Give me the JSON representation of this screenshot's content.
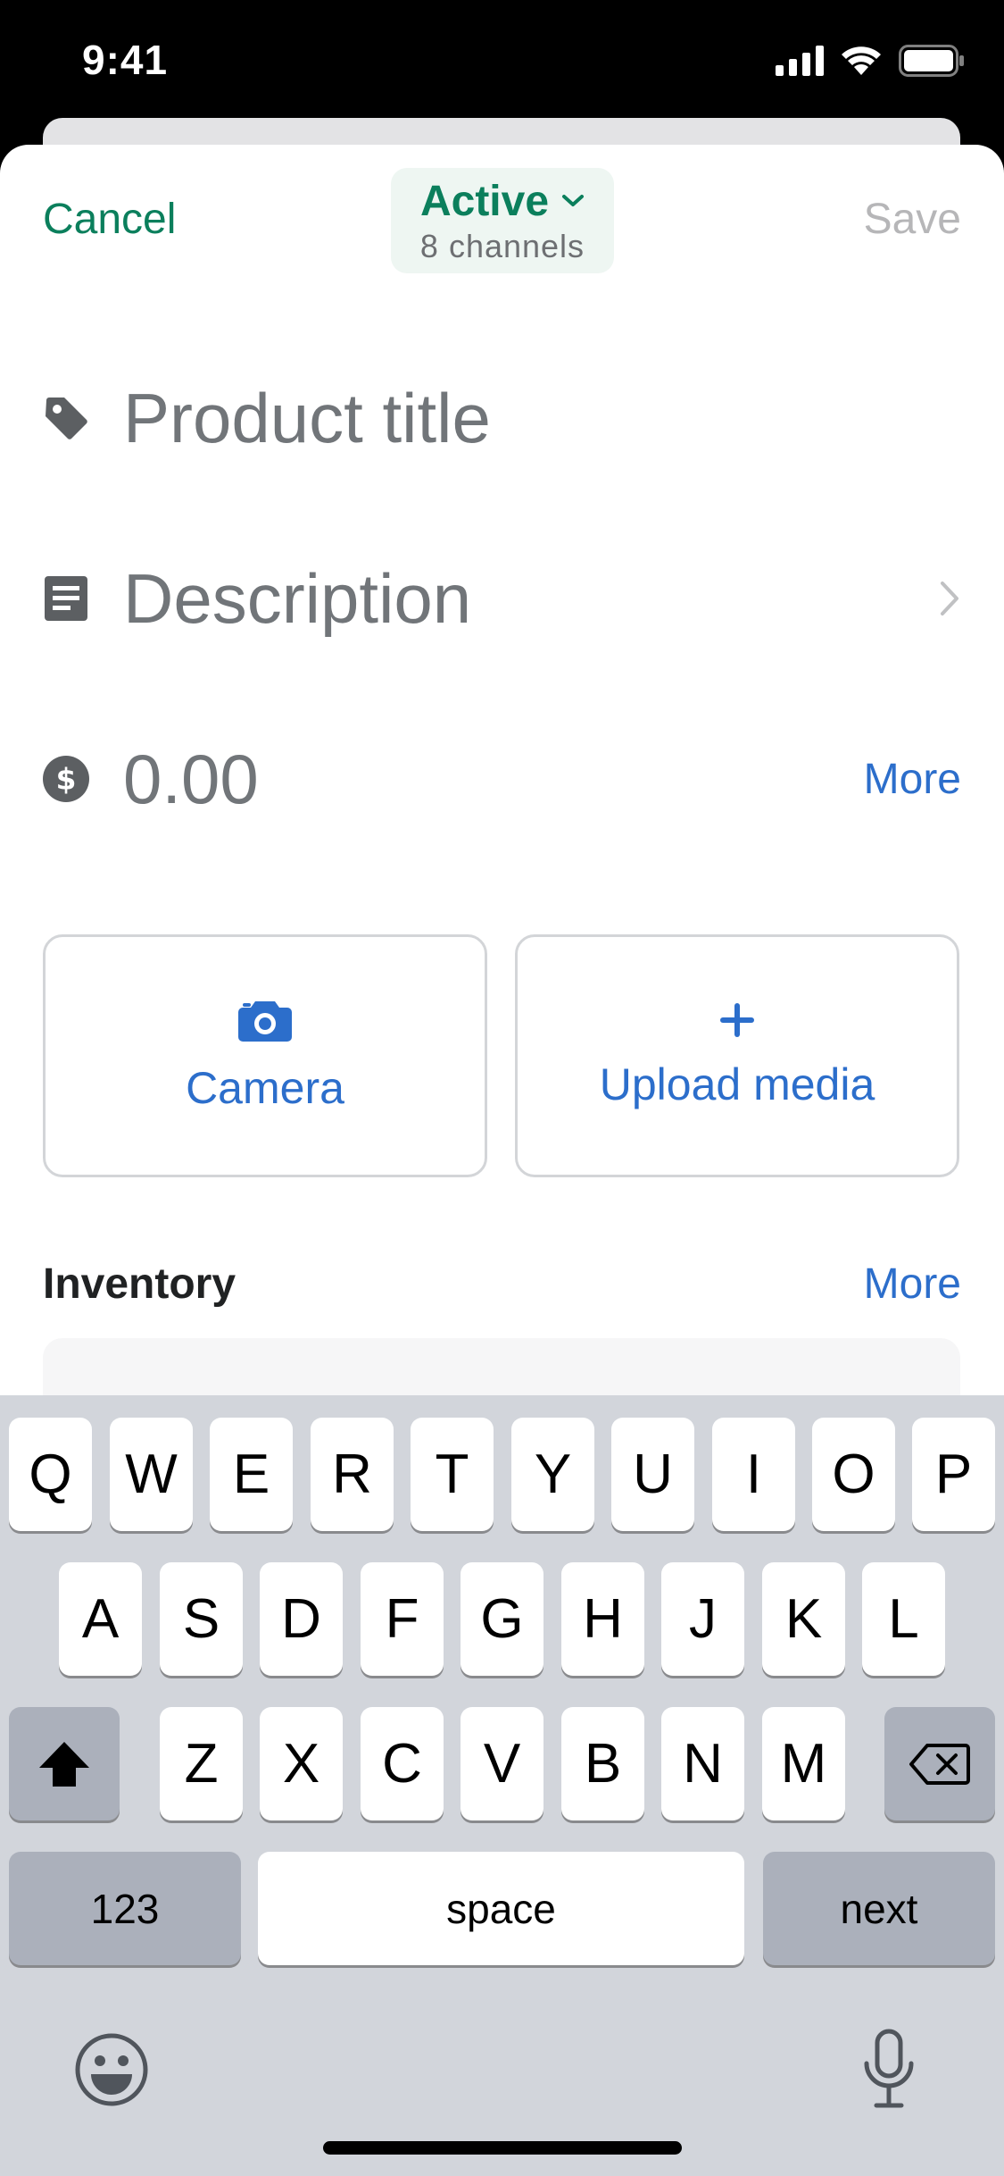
{
  "status_bar": {
    "time": "9:41",
    "icons": [
      "cellular-signal-icon",
      "wifi-icon",
      "battery-icon"
    ]
  },
  "header": {
    "cancel_label": "Cancel",
    "save_label": "Save",
    "status": {
      "title": "Active",
      "subtitle": "8 channels"
    }
  },
  "fields": {
    "title": {
      "placeholder": "Product title",
      "icon": "tag-icon"
    },
    "description": {
      "placeholder": "Description",
      "icon": "document-icon"
    },
    "price": {
      "placeholder": "0.00",
      "icon": "dollar-icon",
      "more_label": "More"
    }
  },
  "media": {
    "camera_label": "Camera",
    "upload_label": "Upload media"
  },
  "inventory": {
    "title": "Inventory",
    "more_label": "More"
  },
  "keyboard": {
    "row1": [
      "Q",
      "W",
      "E",
      "R",
      "T",
      "Y",
      "U",
      "I",
      "O",
      "P"
    ],
    "row2": [
      "A",
      "S",
      "D",
      "F",
      "G",
      "H",
      "J",
      "K",
      "L"
    ],
    "row3": [
      "Z",
      "X",
      "C",
      "V",
      "B",
      "N",
      "M"
    ],
    "numbers_label": "123",
    "space_label": "space",
    "next_label": "next"
  },
  "colors": {
    "accent_green": "#0b7f5c",
    "link_blue": "#2c6ecb",
    "placeholder_gray": "#717579",
    "disabled_gray": "#b6b6b8",
    "keyboard_bg": "#d2d5db"
  }
}
